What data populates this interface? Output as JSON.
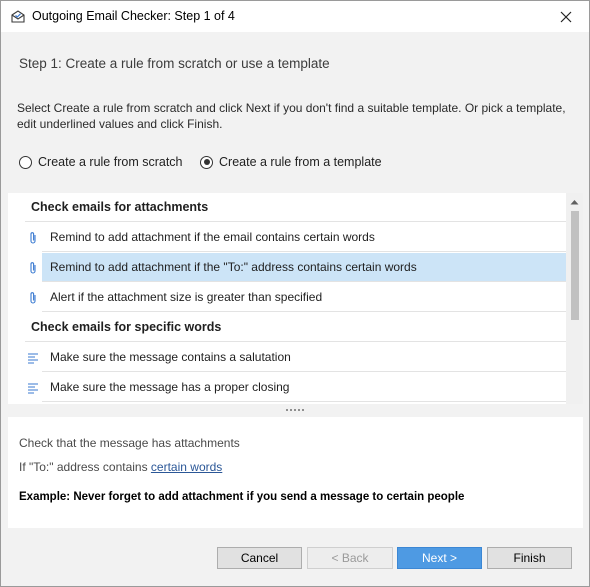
{
  "window": {
    "title": "Outgoing Email Checker: Step 1 of 4"
  },
  "step": {
    "heading": "Step 1: Create a rule from scratch or use a template",
    "instructions": "Select Create a rule from scratch and click Next if you don't find a suitable template. Or pick a template, edit underlined values and click Finish."
  },
  "options": {
    "scratch_label": "Create a rule from scratch",
    "template_label": "Create a rule from a template",
    "selected": "template"
  },
  "templates": {
    "groups": [
      {
        "header": "Check emails for attachments",
        "icon": "paperclip-icon",
        "items": [
          "Remind to add attachment if the email contains certain words",
          "Remind to add attachment if the \"To:\" address contains certain words",
          "Alert if the attachment size is greater than specified"
        ]
      },
      {
        "header": "Check emails for specific words",
        "icon": "text-lines-icon",
        "items": [
          "Make sure the message contains a salutation",
          "Make sure the message has a proper closing"
        ]
      }
    ],
    "selected_item": "Remind to add attachment if the \"To:\" address contains certain words"
  },
  "details": {
    "line1": "Check that the message has attachments",
    "line2_prefix": "If \"To:\" address contains ",
    "line2_link": "certain words",
    "example": "Example: Never forget to add attachment if you send a message to certain people"
  },
  "buttons": {
    "cancel": "Cancel",
    "back": "< Back",
    "next": "Next >",
    "finish": "Finish"
  },
  "colors": {
    "selection": "#cce4f7",
    "link": "#2b5797",
    "primary_button": "#4e9ae3"
  }
}
